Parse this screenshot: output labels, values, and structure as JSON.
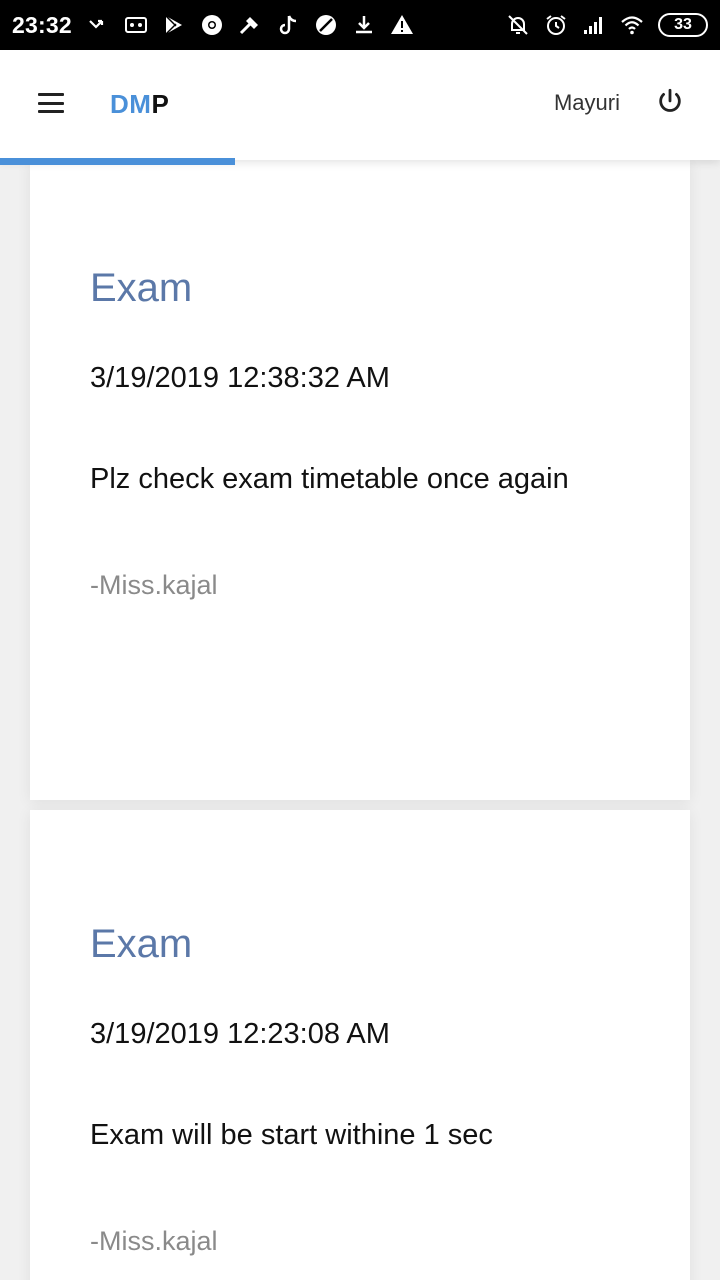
{
  "status_bar": {
    "time": "23:32",
    "battery": "33",
    "icons": [
      "missed-call-icon",
      "voicemail-icon",
      "play-store-icon",
      "chrome-icon",
      "tools-icon",
      "tiktok-icon",
      "app-icon",
      "download-icon",
      "warning-icon",
      "notifications-off-icon",
      "alarm-icon",
      "signal-icon",
      "wifi-icon"
    ]
  },
  "header": {
    "brand_part1": "DM",
    "brand_part2": "P",
    "username": "Mayuri",
    "progress_percent": 32.6,
    "accent_color": "#4a90d9"
  },
  "notices": [
    {
      "title": "Exam",
      "date": "3/19/2019 12:38:32 AM",
      "message": "Plz check exam timetable once again",
      "author": "-Miss.kajal"
    },
    {
      "title": "Exam",
      "date": "3/19/2019 12:23:08 AM",
      "message": "Exam will be start withine 1 sec",
      "author": "-Miss.kajal"
    }
  ]
}
